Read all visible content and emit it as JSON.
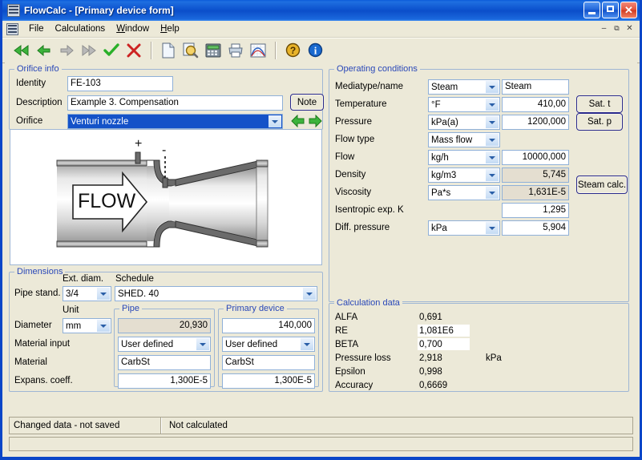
{
  "window": {
    "title": "FlowCalc - [Primary device form]",
    "icon": "app-icon",
    "buttons": {
      "minimize": "minimize",
      "maximize": "maximize",
      "close": "close"
    },
    "mdi_buttons": {
      "minimize": "–",
      "restore": "❐",
      "close": "✕"
    }
  },
  "menu": {
    "items": [
      "File",
      "Calculations",
      "Window",
      "Help"
    ]
  },
  "toolbar": {
    "items": [
      {
        "name": "first-record-icon",
        "glyph": "◀◀",
        "color": "#2ab02a"
      },
      {
        "name": "previous-record-icon",
        "glyph": "◀",
        "color": "#2ab02a"
      },
      {
        "name": "next-record-icon",
        "glyph": "▶",
        "color": "#9e9e9e"
      },
      {
        "name": "last-record-icon",
        "glyph": "▶▶",
        "color": "#9e9e9e"
      },
      {
        "name": "accept-icon",
        "glyph": "✔",
        "color": "#2ab02a"
      },
      {
        "name": "cancel-icon",
        "glyph": "✖",
        "color": "#cc2020"
      },
      {
        "name": "new-document-icon",
        "glyph": "",
        "color": "#e8f0fa"
      },
      {
        "name": "find-icon",
        "glyph": "",
        "color": "#e8c34a"
      },
      {
        "name": "calculator-icon",
        "glyph": "",
        "color": "#5a6a80"
      },
      {
        "name": "print-icon",
        "glyph": "",
        "color": "#b8c6d8"
      },
      {
        "name": "chart-icon",
        "glyph": "",
        "color": "#4a7ac0"
      },
      {
        "name": "help-icon",
        "glyph": "?",
        "color": "#e0a420"
      },
      {
        "name": "info-icon",
        "glyph": "i",
        "color": "#1a6ad0"
      }
    ]
  },
  "orifice_info": {
    "title": "Orifice info",
    "identity_label": "Identity",
    "identity_value": "FE-103",
    "description_label": "Description",
    "description_value": "Example 3. Compensation",
    "note_button": "Note",
    "orifice_label": "Orifice",
    "orifice_value": "Venturi nozzle",
    "prev_arrow": "prev-orifice",
    "next_arrow": "next-orifice"
  },
  "diagram": {
    "flow_label": "FLOW",
    "plus_tap": "+",
    "minus_tap": "-",
    "device": "Venturi nozzle"
  },
  "operating_conditions": {
    "title": "Operating conditions",
    "rows": [
      {
        "label": "Mediatype/name",
        "unit": "Steam",
        "value": "Steam",
        "value_align": "left",
        "readonly": false,
        "has_combo": true,
        "has_value": true
      },
      {
        "label": "Temperature",
        "unit": "°F",
        "value": "410,00",
        "value_align": "right",
        "readonly": false,
        "has_combo": true,
        "has_value": true
      },
      {
        "label": "Pressure",
        "unit": "kPa(a)",
        "value": "1200,000",
        "value_align": "right",
        "readonly": false,
        "has_combo": true,
        "has_value": true
      },
      {
        "label": "Flow type",
        "unit": "Mass flow",
        "value": "",
        "value_align": "right",
        "readonly": false,
        "has_combo": true,
        "has_value": false
      },
      {
        "label": "Flow",
        "unit": "kg/h",
        "value": "10000,000",
        "value_align": "right",
        "readonly": false,
        "has_combo": true,
        "has_value": true
      },
      {
        "label": "Density",
        "unit": "kg/m3",
        "value": "5,745",
        "value_align": "right",
        "readonly": true,
        "has_combo": true,
        "has_value": true
      },
      {
        "label": "Viscosity",
        "unit": "Pa*s",
        "value": "1,631E-5",
        "value_align": "right",
        "readonly": true,
        "has_combo": true,
        "has_value": true
      },
      {
        "label": "Isentropic exp. K",
        "unit": "",
        "value": "1,295",
        "value_align": "right",
        "readonly": false,
        "has_combo": false,
        "has_value": true
      },
      {
        "label": "Diff. pressure",
        "unit": "kPa",
        "value": "5,904",
        "value_align": "right",
        "readonly": false,
        "has_combo": true,
        "has_value": true
      }
    ],
    "sat_t_button": "Sat. t",
    "sat_p_button": "Sat. p",
    "steam_calc_button": "Steam calc."
  },
  "dimensions": {
    "title": "Dimensions",
    "ext_diam_label": "Ext. diam.",
    "schedule_label": "Schedule",
    "pipe_stand_label": "Pipe stand.",
    "ext_diam_value": "3/4",
    "schedule_value": "SHED. 40",
    "unit_label": "Unit",
    "diameter_label": "Diameter",
    "unit_value": "mm",
    "material_input_label": "Material input",
    "material_label": "Material",
    "expans_label": "Expans. coeff.",
    "pipe": {
      "title": "Pipe",
      "diameter": "20,930",
      "diameter_readonly": true,
      "material_input": "User defined",
      "material": "CarbSt",
      "expans_coeff": "1,300E-5"
    },
    "primary_device": {
      "title": "Primary device",
      "diameter": "140,000",
      "diameter_readonly": false,
      "material_input": "User defined",
      "material": "CarbSt",
      "expans_coeff": "1,300E-5"
    }
  },
  "calculation_data": {
    "title": "Calculation data",
    "rows": [
      {
        "label": "ALFA",
        "value": "0,691",
        "unit": "",
        "highlight": false
      },
      {
        "label": "RE",
        "value": "1,081E6",
        "unit": "",
        "highlight": true
      },
      {
        "label": "BETA",
        "value": "0,700",
        "unit": "",
        "highlight": true
      },
      {
        "label": "Pressure loss",
        "value": "2,918",
        "unit": "kPa",
        "highlight": false
      },
      {
        "label": "Epsilon",
        "value": "0,998",
        "unit": "",
        "highlight": false
      },
      {
        "label": "Accuracy",
        "value": "0,6669",
        "unit": "",
        "highlight": false
      }
    ]
  },
  "status_bar": {
    "left": "Changed data - not saved",
    "right": "Not calculated"
  },
  "colors": {
    "titlebar": "#0d53cf",
    "window_bg": "#ece9d8",
    "group_label": "#2a48b8",
    "field_border": "#8fb0d8",
    "readonly_field": "#e4ded0",
    "selection": "#1452c8",
    "button_border": "#2a2a8c"
  }
}
